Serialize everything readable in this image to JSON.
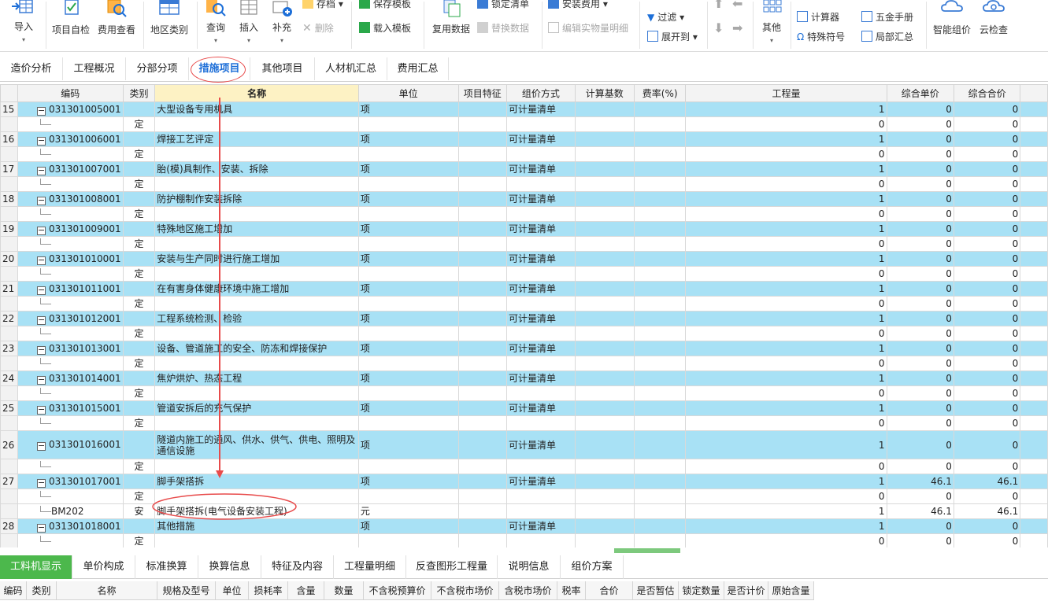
{
  "ribbon": {
    "import": "导入",
    "self_check": "项目自检",
    "fee_view": "费用查看",
    "region_category": "地区类别",
    "query": "查询",
    "insert": "插入",
    "supplement": "补充",
    "store": "存档",
    "delete": "删除",
    "save_template": "保存模板",
    "load_template": "载入模板",
    "reuse_data": "复用数据",
    "lock_list": "锁定清单",
    "replace_data": "替换数据",
    "edit_entity_detail": "编辑实物量明细",
    "install_fee": "安装费用",
    "filter": "过滤",
    "expand_to": "展开到",
    "other": "其他",
    "calculator": "计算器",
    "hardware_manual": "五金手册",
    "special_symbol": "特殊符号",
    "local_summary": "局部汇总",
    "smart_pricing": "智能组价",
    "cloud_check": "云检查"
  },
  "tabs": [
    "造价分析",
    "工程概况",
    "分部分项",
    "措施项目",
    "其他项目",
    "人材机汇总",
    "费用汇总"
  ],
  "active_tab": "措施项目",
  "grid": {
    "columns": [
      "编码",
      "类别",
      "名称",
      "单位",
      "项目特征",
      "组价方式",
      "计算基数",
      "费率(%)",
      "工程量",
      "综合单价",
      "综合合价"
    ],
    "rows": [
      {
        "type": "qd",
        "no": "15",
        "code": "031301005001",
        "cat": "",
        "name": "大型设备专用机具",
        "unit": "项",
        "method": "可计量清单",
        "qty": "1",
        "price": "0",
        "total": "0"
      },
      {
        "type": "sub",
        "no": "",
        "code": "",
        "cat": "定",
        "name": "",
        "unit": "",
        "method": "",
        "qty": "0",
        "price": "0",
        "total": "0"
      },
      {
        "type": "qd",
        "no": "16",
        "code": "031301006001",
        "cat": "",
        "name": "焊接工艺评定",
        "unit": "项",
        "method": "可计量清单",
        "qty": "1",
        "price": "0",
        "total": "0"
      },
      {
        "type": "sub",
        "no": "",
        "code": "",
        "cat": "定",
        "name": "",
        "unit": "",
        "method": "",
        "qty": "0",
        "price": "0",
        "total": "0"
      },
      {
        "type": "qd",
        "no": "17",
        "code": "031301007001",
        "cat": "",
        "name": "胎(模)具制作、安装、拆除",
        "unit": "项",
        "method": "可计量清单",
        "qty": "1",
        "price": "0",
        "total": "0"
      },
      {
        "type": "sub",
        "no": "",
        "code": "",
        "cat": "定",
        "name": "",
        "unit": "",
        "method": "",
        "qty": "0",
        "price": "0",
        "total": "0"
      },
      {
        "type": "qd",
        "no": "18",
        "code": "031301008001",
        "cat": "",
        "name": "防护棚制作安装拆除",
        "unit": "项",
        "method": "可计量清单",
        "qty": "1",
        "price": "0",
        "total": "0"
      },
      {
        "type": "sub",
        "no": "",
        "code": "",
        "cat": "定",
        "name": "",
        "unit": "",
        "method": "",
        "qty": "0",
        "price": "0",
        "total": "0"
      },
      {
        "type": "qd",
        "no": "19",
        "code": "031301009001",
        "cat": "",
        "name": "特殊地区施工增加",
        "unit": "项",
        "method": "可计量清单",
        "qty": "1",
        "price": "0",
        "total": "0"
      },
      {
        "type": "sub",
        "no": "",
        "code": "",
        "cat": "定",
        "name": "",
        "unit": "",
        "method": "",
        "qty": "0",
        "price": "0",
        "total": "0"
      },
      {
        "type": "qd",
        "no": "20",
        "code": "031301010001",
        "cat": "",
        "name": "安装与生产同时进行施工增加",
        "unit": "项",
        "method": "可计量清单",
        "qty": "1",
        "price": "0",
        "total": "0"
      },
      {
        "type": "sub",
        "no": "",
        "code": "",
        "cat": "定",
        "name": "",
        "unit": "",
        "method": "",
        "qty": "0",
        "price": "0",
        "total": "0"
      },
      {
        "type": "qd",
        "no": "21",
        "code": "031301011001",
        "cat": "",
        "name": "在有害身体健康环境中施工增加",
        "unit": "项",
        "method": "可计量清单",
        "qty": "1",
        "price": "0",
        "total": "0"
      },
      {
        "type": "sub",
        "no": "",
        "code": "",
        "cat": "定",
        "name": "",
        "unit": "",
        "method": "",
        "qty": "0",
        "price": "0",
        "total": "0"
      },
      {
        "type": "qd",
        "no": "22",
        "code": "031301012001",
        "cat": "",
        "name": "工程系统检测、检验",
        "unit": "项",
        "method": "可计量清单",
        "qty": "1",
        "price": "0",
        "total": "0"
      },
      {
        "type": "sub",
        "no": "",
        "code": "",
        "cat": "定",
        "name": "",
        "unit": "",
        "method": "",
        "qty": "0",
        "price": "0",
        "total": "0"
      },
      {
        "type": "qd",
        "no": "23",
        "code": "031301013001",
        "cat": "",
        "name": "设备、管道施工的安全、防冻和焊接保护",
        "unit": "项",
        "method": "可计量清单",
        "qty": "1",
        "price": "0",
        "total": "0"
      },
      {
        "type": "sub",
        "no": "",
        "code": "",
        "cat": "定",
        "name": "",
        "unit": "",
        "method": "",
        "qty": "0",
        "price": "0",
        "total": "0"
      },
      {
        "type": "qd",
        "no": "24",
        "code": "031301014001",
        "cat": "",
        "name": "焦炉烘炉、热态工程",
        "unit": "项",
        "method": "可计量清单",
        "qty": "1",
        "price": "0",
        "total": "0"
      },
      {
        "type": "sub",
        "no": "",
        "code": "",
        "cat": "定",
        "name": "",
        "unit": "",
        "method": "",
        "qty": "0",
        "price": "0",
        "total": "0"
      },
      {
        "type": "qd",
        "no": "25",
        "code": "031301015001",
        "cat": "",
        "name": "管道安拆后的充气保护",
        "unit": "项",
        "method": "可计量清单",
        "qty": "1",
        "price": "0",
        "total": "0"
      },
      {
        "type": "sub",
        "no": "",
        "code": "",
        "cat": "定",
        "name": "",
        "unit": "",
        "method": "",
        "qty": "0",
        "price": "0",
        "total": "0"
      },
      {
        "type": "qd tall",
        "no": "26",
        "code": "031301016001",
        "cat": "",
        "name": "隧道内施工的通风、供水、供气、供电、照明及通信设施",
        "unit": "项",
        "method": "可计量清单",
        "qty": "1",
        "price": "0",
        "total": "0"
      },
      {
        "type": "sub",
        "no": "",
        "code": "",
        "cat": "定",
        "name": "",
        "unit": "",
        "method": "",
        "qty": "0",
        "price": "0",
        "total": "0"
      },
      {
        "type": "qd",
        "no": "27",
        "code": "031301017001",
        "cat": "",
        "name": "脚手架搭拆",
        "unit": "项",
        "method": "可计量清单",
        "qty": "1",
        "price": "46.1",
        "total": "46.1"
      },
      {
        "type": "sub",
        "no": "",
        "code": "",
        "cat": "定",
        "name": "",
        "unit": "",
        "method": "",
        "qty": "0",
        "price": "0",
        "total": "0"
      },
      {
        "type": "sub2",
        "no": "",
        "code": "BM202",
        "cat": "安",
        "name": "脚手架搭拆(电气设备安装工程)",
        "unit": "元",
        "method": "",
        "qty": "1",
        "price": "46.1",
        "total": "46.1"
      },
      {
        "type": "qd",
        "no": "28",
        "code": "031301018001",
        "cat": "",
        "name": "其他措施",
        "unit": "项",
        "method": "可计量清单",
        "qty": "1",
        "price": "0",
        "total": "0"
      },
      {
        "type": "sub",
        "no": "",
        "code": "",
        "cat": "定",
        "name": "",
        "unit": "",
        "method": "",
        "qty": "0",
        "price": "0",
        "total": "0"
      }
    ]
  },
  "bottom_tabs": [
    "工料机显示",
    "单价构成",
    "标准换算",
    "换算信息",
    "特征及内容",
    "工程量明细",
    "反查图形工程量",
    "说明信息",
    "组价方案"
  ],
  "bottom_columns": [
    "编码",
    "类别",
    "名称",
    "规格及型号",
    "单位",
    "损耗率",
    "含量",
    "数量",
    "不含税预算价",
    "不含税市场价",
    "含税市场价",
    "税率",
    "合价",
    "是否暂估",
    "锁定数量",
    "是否计价",
    "原始含量"
  ],
  "colors": {
    "accent": "#1e6fd8",
    "row_highlight": "#a8e1f5",
    "annotation": "#e84b4b",
    "green_tab": "#4cb84c"
  }
}
